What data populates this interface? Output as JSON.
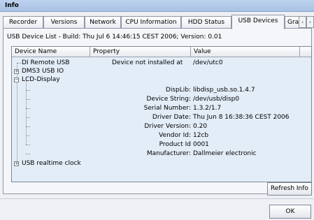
{
  "window": {
    "title": "Info"
  },
  "tabs": [
    {
      "label": "Recorder"
    },
    {
      "label": "Versions"
    },
    {
      "label": "Network"
    },
    {
      "label": "CPU Information"
    },
    {
      "label": "HDD Status"
    },
    {
      "label": "USB Devices",
      "active": true
    },
    {
      "label": "Gra"
    }
  ],
  "tab_scroll": {
    "left": "‹",
    "right": "›"
  },
  "build_info": "USB Device List  - Build: Thu Jul 6 14:46:15 CEST 2006;  Version: 0.01",
  "columns": [
    "Device Name",
    "Property",
    "Value"
  ],
  "devices": [
    {
      "name": "DI Remote USB",
      "property": "Device not installed at",
      "value": "/dev/utc0",
      "expander": ""
    },
    {
      "name": "DMS3 USB IO",
      "expander": "+"
    },
    {
      "name": "LCD-Display",
      "expander": "−"
    },
    {
      "name": "USB realtime clock",
      "expander": "+"
    }
  ],
  "lcd_properties": [
    {
      "property": "DispLib:",
      "value": "libdisp_usb.so.1.4.7"
    },
    {
      "property": "Device String:",
      "value": "/dev/usb/disp0"
    },
    {
      "property": "Serial Number:",
      "value": "1.3.2/1.7"
    },
    {
      "property": "Driver Date:",
      "value": "Thu Jun  8 16:38:36 CEST 2006"
    },
    {
      "property": "Driver Version:",
      "value": "0.20"
    },
    {
      "property": "Vendor Id:",
      "value": "12cb"
    },
    {
      "property": "Product Id",
      "value": "0001"
    },
    {
      "property": "Manufacturer:",
      "value": "Dallmeier electronic"
    }
  ],
  "buttons": {
    "refresh": "Refresh Info",
    "ok": "OK"
  }
}
